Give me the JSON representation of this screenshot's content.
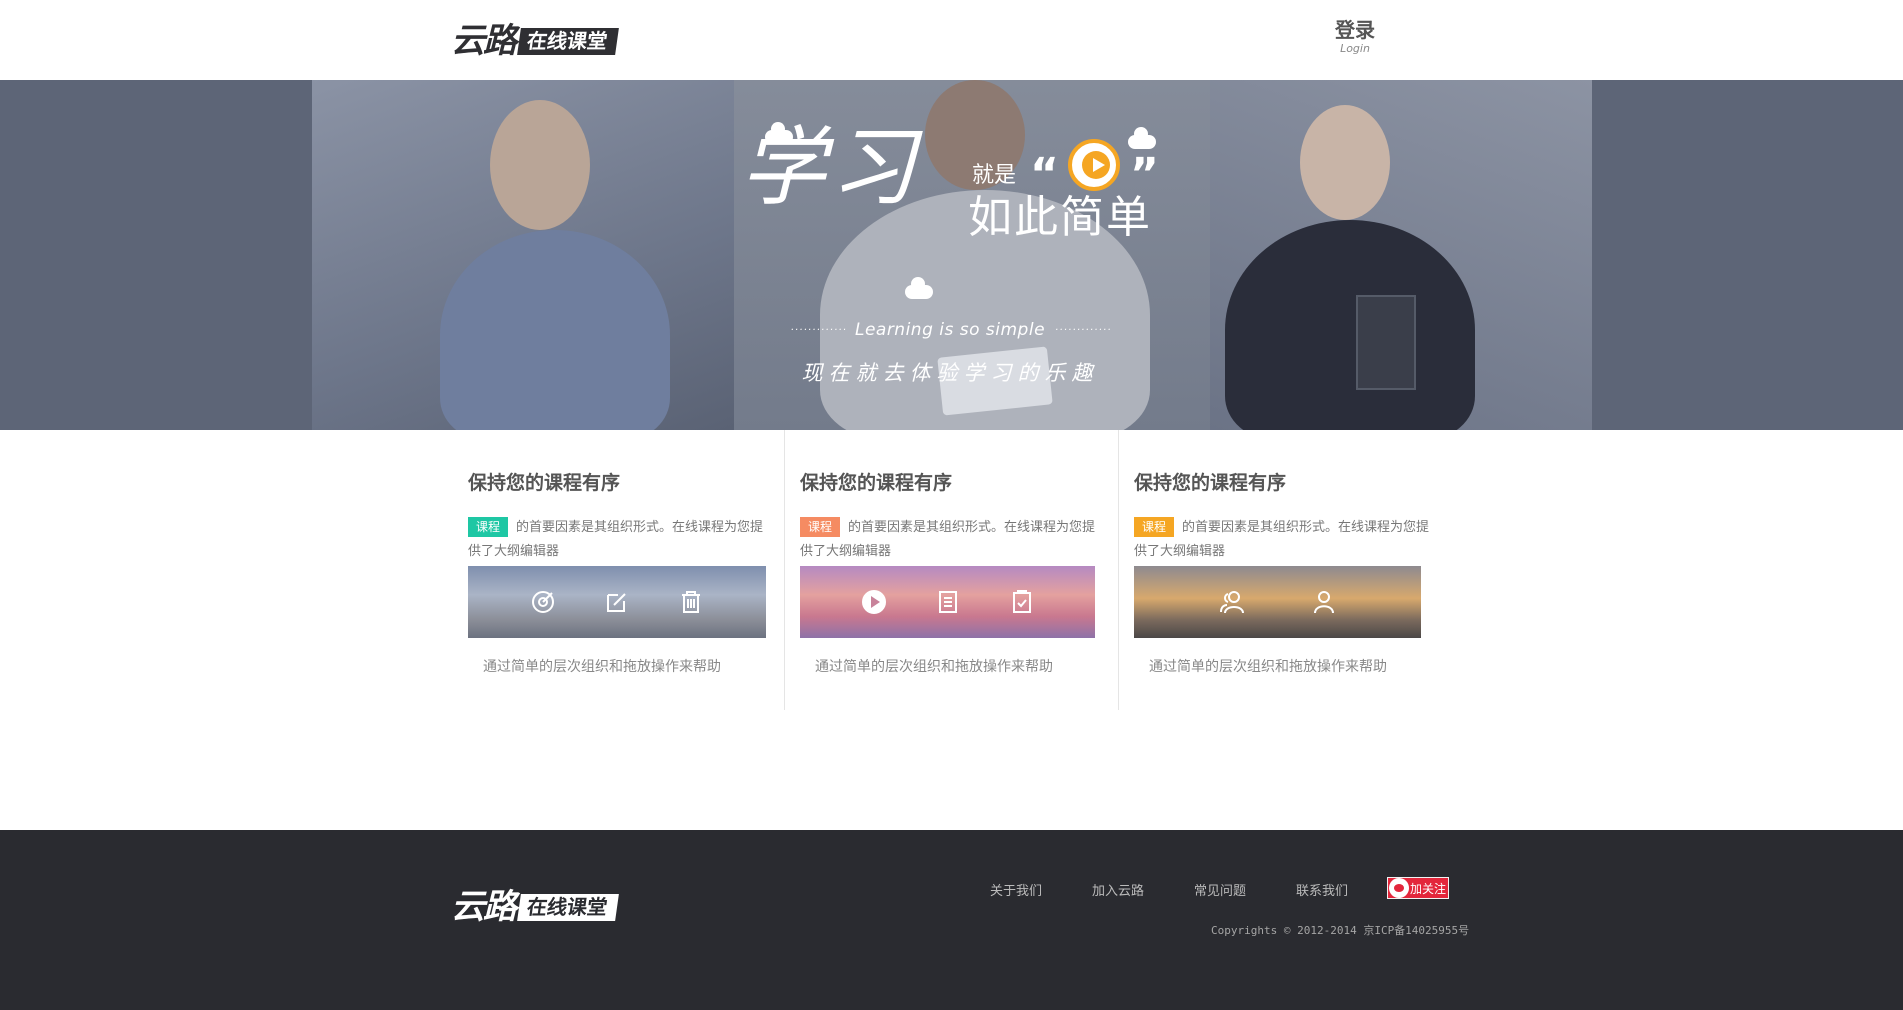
{
  "header": {
    "logo_mark": "云路",
    "logo_tag": "在线课堂",
    "login_zh": "登录",
    "login_en": "Login"
  },
  "banner": {
    "headline_big": "学习",
    "headline_small": "就是",
    "headline_simple": "如此简单",
    "quote_left": "“",
    "quote_right": "”",
    "english": "Learning is so simple",
    "subtitle": "现在就去体验学习的乐趣"
  },
  "features": [
    {
      "title": "保持您的课程有序",
      "badge": "课程",
      "badge_color": "#1ec7a4",
      "desc": "的首要因素是其组织形式。在线课程为您提供了大纲编辑器",
      "icons": [
        "target-icon",
        "edit-icon",
        "trash-icon"
      ],
      "footer": "通过简单的层次组织和拖放操作来帮助"
    },
    {
      "title": "保持您的课程有序",
      "badge": "课程",
      "badge_color": "#f58b62",
      "desc": "的首要因素是其组织形式。在线课程为您提供了大纲编辑器",
      "icons": [
        "play-icon",
        "document-icon",
        "checklist-icon"
      ],
      "footer": "通过简单的层次组织和拖放操作来帮助"
    },
    {
      "title": "保持您的课程有序",
      "badge": "课程",
      "badge_color": "#f5a623",
      "desc": "的首要因素是其组织形式。在线课程为您提供了大纲编辑器",
      "icons": [
        "users-icon",
        "user-icon"
      ],
      "footer": "通过简单的层次组织和拖放操作来帮助"
    }
  ],
  "footer": {
    "logo_mark": "云路",
    "logo_tag": "在线课堂",
    "nav": [
      "关于我们",
      "加入云路",
      "常见问题",
      "联系我们"
    ],
    "weibo_label": "加关注",
    "copyright": "Copyrights © 2012-2014 京ICP备14025955号"
  }
}
